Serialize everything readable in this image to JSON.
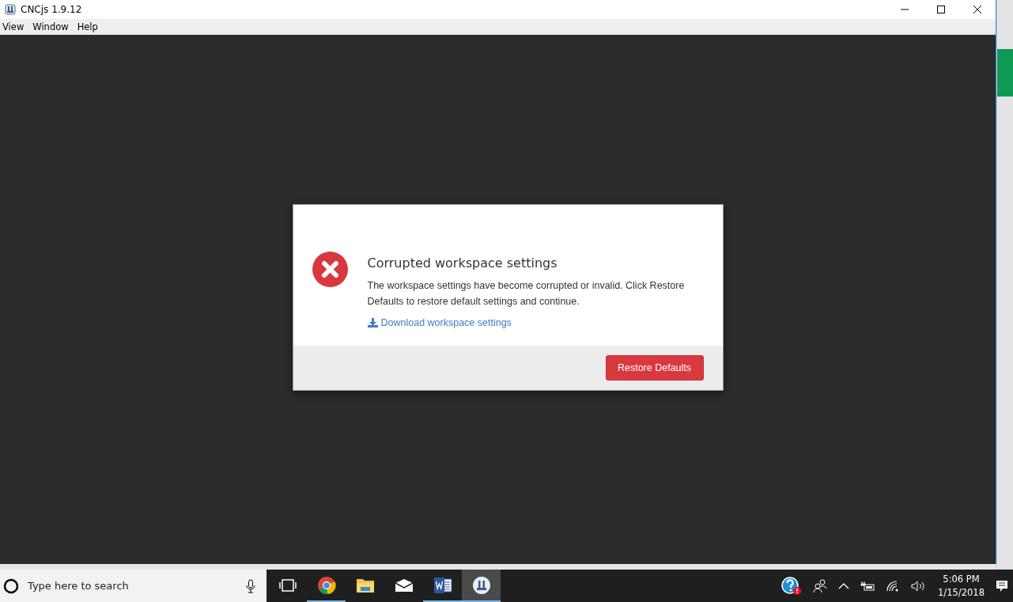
{
  "window": {
    "title": "CNCjs 1.9.12"
  },
  "menu": [
    "View",
    "Window",
    "Help"
  ],
  "dialog": {
    "title": "Corrupted workspace settings",
    "message": "The workspace settings have become corrupted or invalid. Click Restore Defaults to restore default settings and continue.",
    "link": "Download workspace settings",
    "button": "Restore Defaults"
  },
  "taskbar": {
    "search": {
      "placeholder": "Type here to search"
    },
    "apps": [
      {
        "kind": "taskview",
        "running": false,
        "selected": false
      },
      {
        "kind": "chrome",
        "running": true,
        "selected": false
      },
      {
        "kind": "folder",
        "running": false,
        "selected": false
      },
      {
        "kind": "mail",
        "running": false,
        "selected": false
      },
      {
        "kind": "word",
        "running": true,
        "selected": false
      },
      {
        "kind": "cncjs",
        "running": true,
        "selected": true
      }
    ],
    "clock": {
      "time": "5:06 PM",
      "date": "1/15/2018"
    }
  }
}
